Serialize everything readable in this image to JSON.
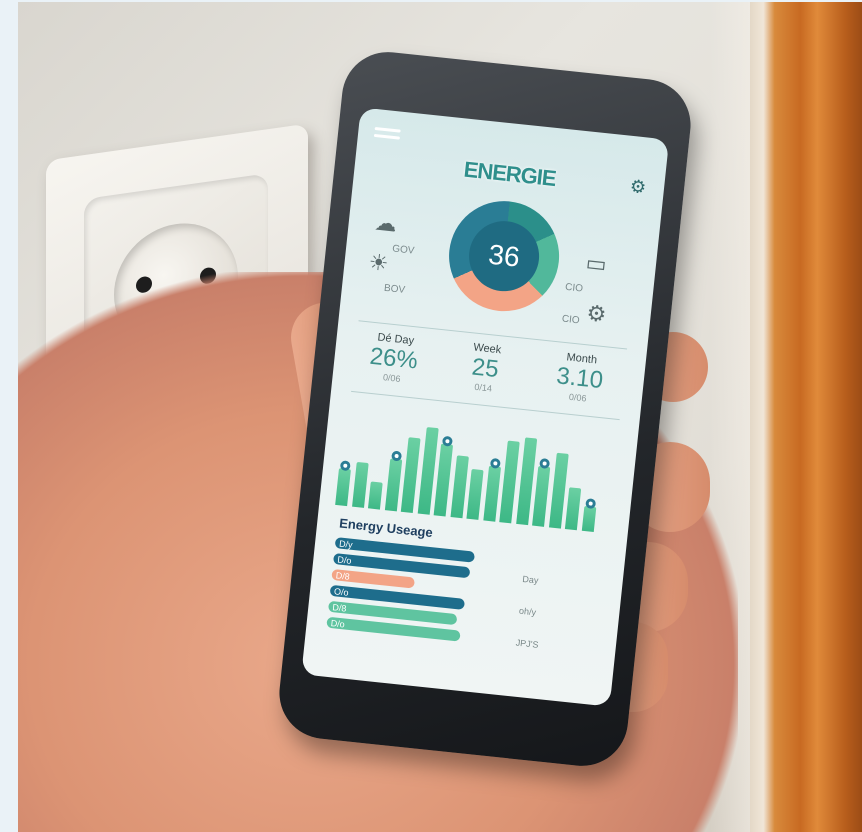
{
  "app": {
    "title": "ENERGIE"
  },
  "gauge": {
    "value": "36"
  },
  "side_icons": {
    "top_left_label": "GOV",
    "left_label": "BOV",
    "right_label": "CIO",
    "right2_label": "CIO"
  },
  "stats": [
    {
      "head": "Dé Day",
      "value": "26%",
      "sub": "0/06"
    },
    {
      "head": "Week",
      "value": "25",
      "sub": "0/14"
    },
    {
      "head": "Month",
      "value": "3.10",
      "sub": "0/06"
    }
  ],
  "usage": {
    "title": "Energy Useage",
    "rows": [
      {
        "label": "D/y",
        "fill": 0.93,
        "color": "#1e6d8c",
        "right": ""
      },
      {
        "label": "D/o",
        "fill": 0.91,
        "color": "#1e6d8c",
        "right": "Day"
      },
      {
        "label": "D/8",
        "fill": 0.55,
        "color": "#f3a486",
        "right": ""
      },
      {
        "label": "O/o",
        "fill": 0.9,
        "color": "#1e6d8c",
        "right": "oh/y"
      },
      {
        "label": "D/8",
        "fill": 0.86,
        "color": "#5fc4a0",
        "right": ""
      },
      {
        "label": "D/o",
        "fill": 0.89,
        "color": "#5fc4a0",
        "right": "JPJ'S"
      }
    ]
  },
  "chart_data": {
    "type": "bar",
    "values": [
      30,
      36,
      22,
      42,
      60,
      70,
      58,
      50,
      40,
      44,
      66,
      70,
      48,
      60,
      34,
      20
    ]
  }
}
